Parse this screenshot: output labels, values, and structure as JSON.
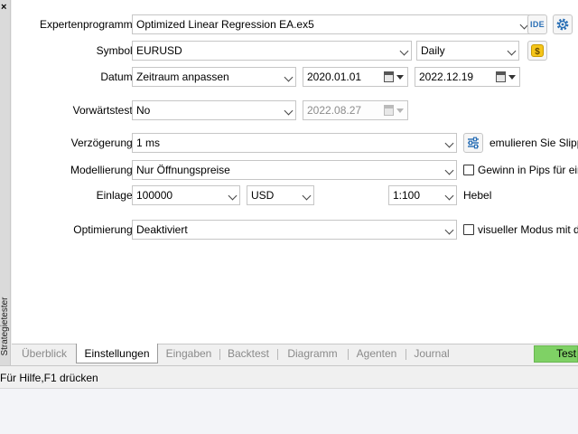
{
  "sidebar": {
    "close_glyph": "×",
    "label": "Strategietester"
  },
  "fields": {
    "expert": {
      "label": "Expertenprogramm:",
      "value": "Optimized Linear Regression EA.ex5",
      "ide_label": "IDE"
    },
    "symbol": {
      "label": "Symbol:",
      "value": "EURUSD",
      "period": "Daily"
    },
    "date": {
      "label": "Datum:",
      "range": "Zeitraum anpassen",
      "from": "2020.01.01",
      "to": "2022.12.19"
    },
    "forward": {
      "label": "Vorwärtstest:",
      "value": "No",
      "date": "2022.08.27"
    },
    "delay": {
      "label": "Verzögerung:",
      "value": "1 ms",
      "slippage_text": "emulieren Sie Slippag"
    },
    "modeling": {
      "label": "Modellierung:",
      "value": "Nur Öffnungspreise",
      "pips_text": "Gewinn in Pips für eine"
    },
    "deposit": {
      "label": "Einlage:",
      "value": "100000",
      "currency": "USD",
      "leverage": "1:100",
      "leverage_label": "Hebel"
    },
    "optimization": {
      "label": "Optimierung:",
      "value": "Deaktiviert",
      "visual_text": "visueller Modus mit der"
    }
  },
  "tabs": [
    {
      "label": "Überblick"
    },
    {
      "label": "Einstellungen",
      "active": true
    },
    {
      "label": "Eingaben"
    },
    {
      "label": "Backtest"
    },
    {
      "label": "Diagramm"
    },
    {
      "label": "Agenten"
    },
    {
      "label": "Journal"
    }
  ],
  "start_button": "Test",
  "status": {
    "text": "Für Hilfe,F1 drücken"
  },
  "colors": {
    "start_button": "#7fd165",
    "coin_icon": "#f5c518",
    "accent": "#2a6fb5"
  },
  "icons": [
    "close-icon",
    "gear-icon",
    "coin-icon",
    "sliders-icon",
    "calendar-icon",
    "chevron-down-icon"
  ]
}
